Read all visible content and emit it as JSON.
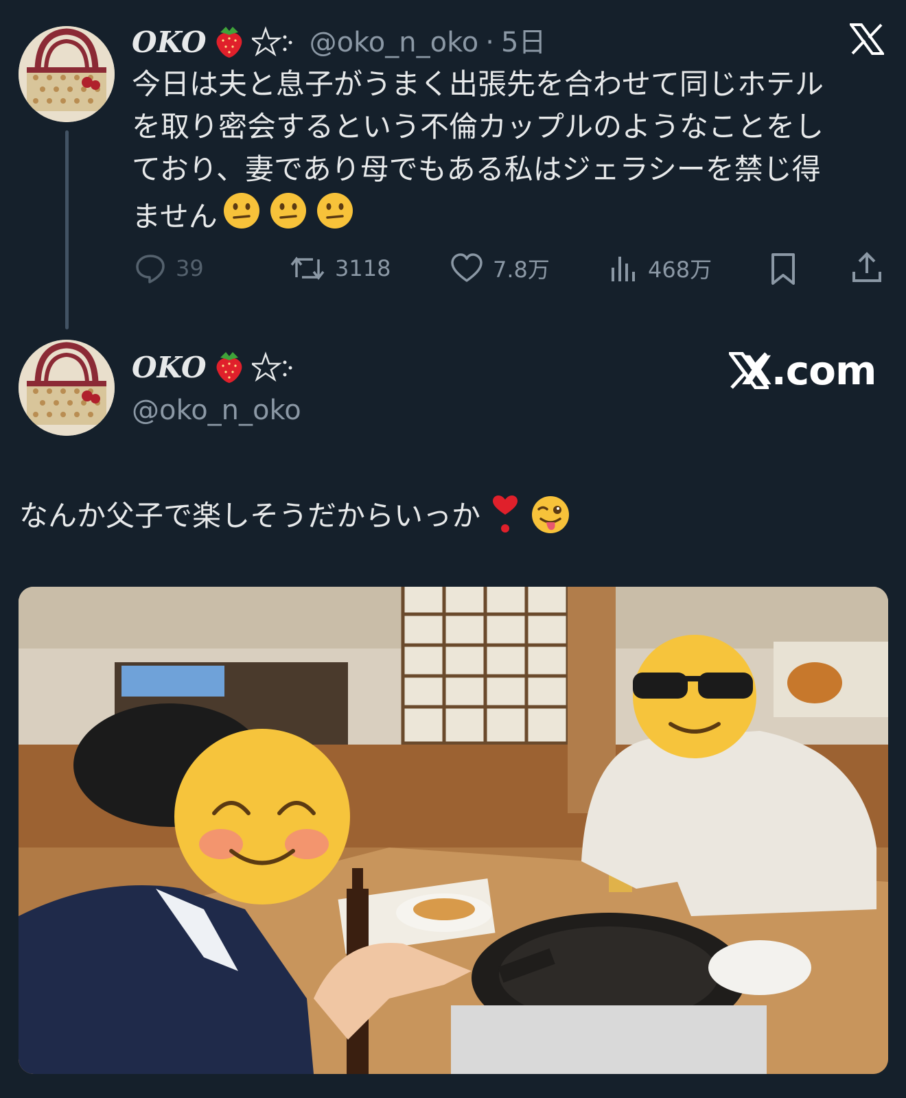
{
  "tweet1": {
    "display_name": "OKO",
    "handle": "@oko_n_oko",
    "separator": "·",
    "time": "5日",
    "lines": [
      "今日は夫と息子がうまく出張先を合わせて同じホテル",
      "を取り密会するという不倫カップルのようなことをし",
      "ており、妻であり母でもある私はジェラシーを禁じ得",
      "ません"
    ],
    "actions": {
      "replies": "39",
      "retweets": "3118",
      "likes": "7.8万",
      "views": "468万"
    }
  },
  "tweet2": {
    "display_name": "OKO",
    "handle": "@oko_n_oko",
    "site": "X.com",
    "text": "なんか父子で楽しそうだからいっか"
  },
  "icons": {
    "name_emoji": "strawberry-icon",
    "name_symbol": "pentagram-sparkle-icon",
    "x_logo": "x-logo-icon",
    "tweet1_emoji": "confused-face-icon",
    "tweet2_emoji_1": "red-heart-exclamation-icon",
    "tweet2_emoji_2": "winking-tongue-face-icon"
  },
  "colors": {
    "background": "#15202b",
    "text": "#e7e9ea",
    "muted": "#8b98a5"
  }
}
